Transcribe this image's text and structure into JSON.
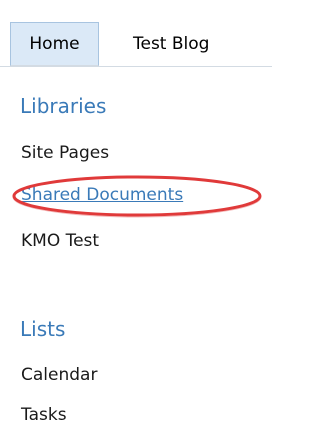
{
  "topnav": {
    "tabs": [
      {
        "label": "Home",
        "selected": true
      },
      {
        "label": "Test Blog",
        "selected": false
      }
    ]
  },
  "quicklaunch": {
    "libraries": {
      "heading": "Libraries",
      "items": [
        {
          "label": "Site Pages"
        },
        {
          "label": "Shared Documents",
          "highlighted": true
        },
        {
          "label": "KMO Test"
        }
      ]
    },
    "lists": {
      "heading": "Lists",
      "items": [
        {
          "label": "Calendar"
        },
        {
          "label": "Tasks"
        }
      ]
    }
  },
  "colors": {
    "heading": "#3a7ab8",
    "selected_tab_bg": "#dbe9f7",
    "highlight_ring": "#e03a3a"
  }
}
